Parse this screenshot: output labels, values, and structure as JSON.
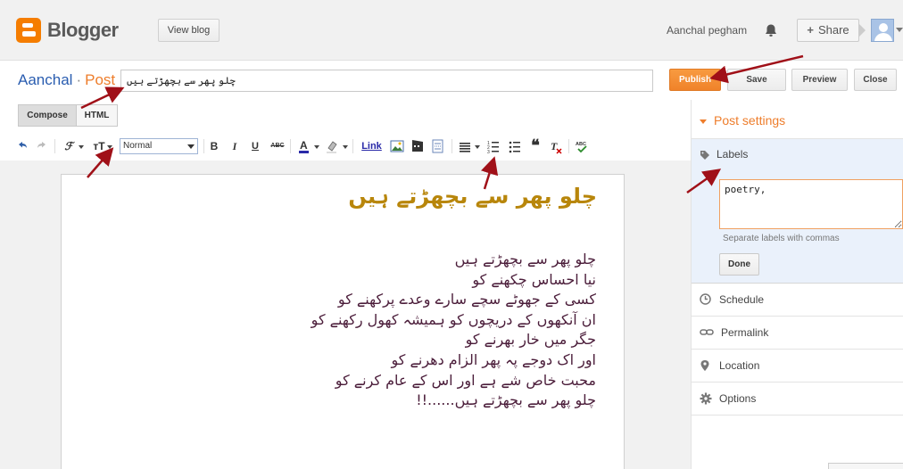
{
  "header": {
    "brand": "Blogger",
    "view_blog": "View blog",
    "username": "Aanchal pegham",
    "share": "Share",
    "icons": [
      "blogger-logo",
      "bell-icon",
      "plus-icon",
      "avatar"
    ]
  },
  "titlebar": {
    "blog_name": "Aanchal",
    "separator": "·",
    "post": "Post",
    "title_value": "چلو پھر سے بچھڑتے ہیں",
    "publish": "Publish",
    "save": "Save",
    "preview": "Preview",
    "close": "Close"
  },
  "editor": {
    "tab_compose": "Compose",
    "tab_html": "HTML",
    "font_size": "Normal",
    "link": "Link",
    "poem_title": "چلو پھر سے بچھڑتے ہیں",
    "lines": [
      "چلو پھر سے بچھڑتے ہیں",
      "نیا احساس چکھنے کو",
      "کسی کے جھوٹے سچے سارے وعدے پرکھنے کو",
      "ان آنکھوں کے دریچوں کو ہمیشہ کھول رکھنے کو",
      "جگر میں خار بھرنے کو",
      "اور اک دوجے پہ پھر الزام دھرنے کو",
      "محبت خاص شے ہے اور اس کے عام کرنے کو",
      "چلو پھر سے بچھڑتے ہیں......!!"
    ]
  },
  "sidebar": {
    "heading": "Post settings",
    "labels_title": "Labels",
    "labels_value": "poetry,",
    "labels_hint": "Separate labels with commas",
    "done": "Done",
    "items": [
      {
        "label": "Schedule",
        "icon": "clock-icon"
      },
      {
        "label": "Permalink",
        "icon": "link-icon"
      },
      {
        "label": "Location",
        "icon": "location-pin-icon"
      },
      {
        "label": "Options",
        "icon": "gear-icon"
      }
    ]
  },
  "colors": {
    "accent": "#ee7d2b",
    "publish": "#f0822a",
    "link_blue": "#2a5db0",
    "annotation_arrow": "#a01018",
    "poem_title": "#b8860b",
    "poem_text": "#4b1d3a"
  }
}
